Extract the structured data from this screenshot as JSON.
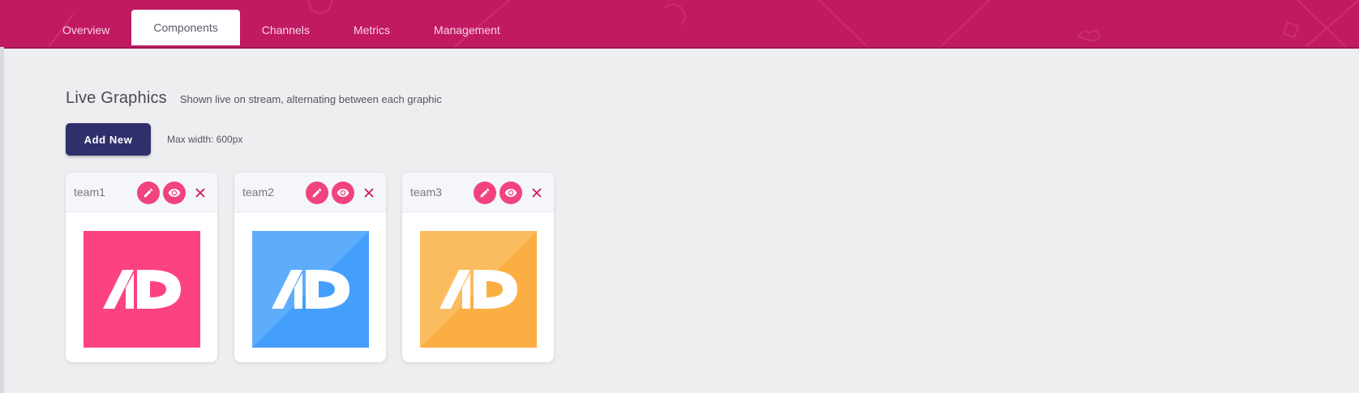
{
  "nav": {
    "tabs": [
      {
        "label": "Overview",
        "active": false
      },
      {
        "label": "Components",
        "active": true
      },
      {
        "label": "Channels",
        "active": false
      },
      {
        "label": "Metrics",
        "active": false
      },
      {
        "label": "Management",
        "active": false
      }
    ]
  },
  "section": {
    "title": "Live Graphics",
    "subtitle": "Shown live on stream, alternating between each graphic",
    "add_button": "Add New",
    "max_width_note": "Max width: 600px"
  },
  "cards": [
    {
      "name": "team1",
      "logo_color": "#fd4282",
      "logo_shade": "#fd4282"
    },
    {
      "name": "team2",
      "logo_color": "#449ffb",
      "logo_shade": "#5eadfb"
    },
    {
      "name": "team3",
      "logo_color": "#fbae42",
      "logo_shade": "#fbbc5f"
    }
  ],
  "colors": {
    "header": "#c21a62",
    "accent_button": "#2e2f6b",
    "icon_button": "#f0437f",
    "close": "#d11a55"
  },
  "icons": {
    "edit": "pencil-icon",
    "view": "eye-icon",
    "delete": "close-icon"
  }
}
